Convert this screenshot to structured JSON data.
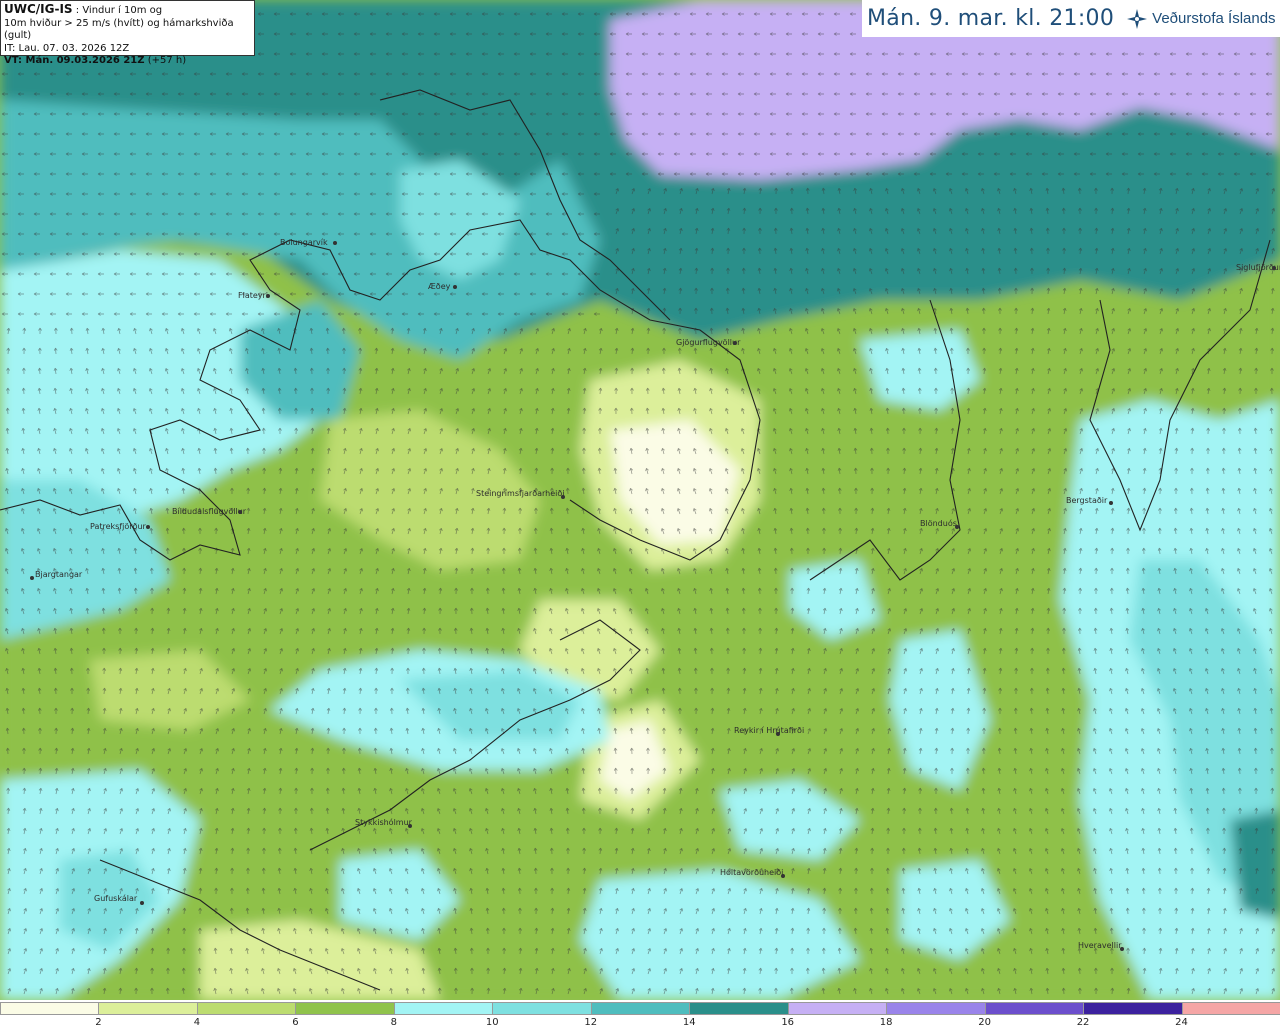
{
  "info": {
    "model": "UWC/IG-IS",
    "line1": ": Vindur í 10m og",
    "line2": "10m hviður > 25 m/s (hvítt) og hámarkshviða (gult)",
    "line3": "IT: Lau. 07. 03. 2026 12Z",
    "vt_label": "VT: Mán. 09.03.2026 21Z",
    "vt_suffix": "(+57 h)"
  },
  "header": {
    "time": "Mán. 9. mar. kl. 21:00",
    "logo_text": "Veðurstofa Íslands"
  },
  "legend": {
    "ticks": [
      "2",
      "4",
      "6",
      "8",
      "10",
      "12",
      "14",
      "16",
      "18",
      "20",
      "22",
      "24"
    ],
    "colors": [
      "#fbfce6",
      "#dcef9a",
      "#bcdc70",
      "#90c34c",
      "#a3f4f4",
      "#7ee0e0",
      "#4fbdbe",
      "#2a8f8a",
      "#c6b0f4",
      "#9a84ea",
      "#6c4fcc",
      "#3c219e",
      "#f5a6a6"
    ]
  },
  "places": [
    {
      "name": "Bolungarvík"
    },
    {
      "name": "Flateyri"
    },
    {
      "name": "Æðey"
    },
    {
      "name": "Gjögurflugvöllur"
    },
    {
      "name": "Siglufjörður"
    },
    {
      "name": "Steingrímsfjarðarheiði"
    },
    {
      "name": "Bíldudalsflugvöllur"
    },
    {
      "name": "Patreksfjörður"
    },
    {
      "name": "Bjargtangar"
    },
    {
      "name": "Blönduós"
    },
    {
      "name": "Bergstaðir"
    },
    {
      "name": "Reykir í Hrútafirði"
    },
    {
      "name": "Stykkishólmur"
    },
    {
      "name": "Holtavörðuheiði"
    },
    {
      "name": "Gufuskálar"
    },
    {
      "name": "Hveravellir"
    }
  ]
}
